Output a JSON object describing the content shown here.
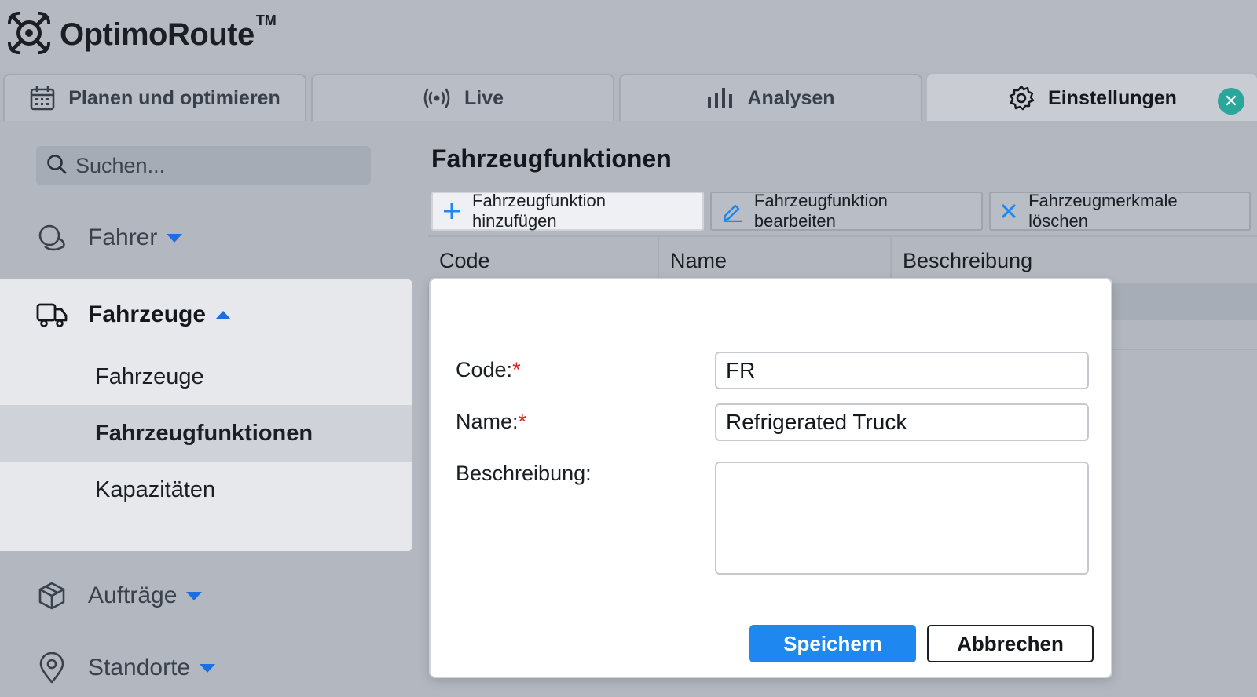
{
  "app": {
    "logo_text": "OptimoRoute",
    "logo_tm": "TM"
  },
  "tabs": [
    {
      "label": "Planen und optimieren",
      "icon": "calendar-icon"
    },
    {
      "label": "Live",
      "icon": "broadcast-icon"
    },
    {
      "label": "Analysen",
      "icon": "bar-chart-icon"
    },
    {
      "label": "Einstellungen",
      "icon": "gear-icon",
      "active": true
    }
  ],
  "sidebar": {
    "search_placeholder": "Suchen...",
    "groups": [
      {
        "label": "Fahrer",
        "icon": "driver-icon",
        "expanded": false
      },
      {
        "label": "Fahrzeuge",
        "icon": "truck-icon",
        "expanded": true
      },
      {
        "label": "Aufträge",
        "icon": "package-icon",
        "expanded": false
      },
      {
        "label": "Standorte",
        "icon": "location-pin-icon",
        "expanded": false
      }
    ],
    "sub_items": [
      {
        "label": "Fahrzeuge"
      },
      {
        "label": "Fahrzeugfunktionen",
        "active": true
      },
      {
        "label": "Kapazitäten"
      }
    ]
  },
  "main": {
    "title": "Fahrzeugfunktionen",
    "toolbar": {
      "add_label": "Fahrzeugfunktion hinzufügen",
      "edit_label": "Fahrzeugfunktion bearbeiten",
      "delete_label": "Fahrzeugmerkmale löschen"
    },
    "columns": [
      "Code",
      "Name",
      "Beschreibung"
    ]
  },
  "modal": {
    "code_label": "Code:",
    "name_label": "Name:",
    "description_label": "Beschreibung:",
    "required_marker": "*",
    "code_value": "FR",
    "name_value": "Refrigerated Truck",
    "description_value": "",
    "save_label": "Speichern",
    "cancel_label": "Abbrechen"
  },
  "colors": {
    "accent": "#1f88f0",
    "caret": "#1b6fe0",
    "close_button": "#2aa69a",
    "required": "#e0201c"
  }
}
